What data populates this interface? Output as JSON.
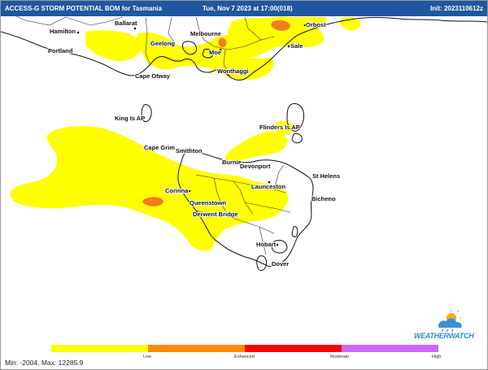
{
  "header": {
    "title": "ACCESS-G STORM POTENTIAL BOM for Tasmania",
    "valid_time": "Tue, Nov 7 2023 at 17:00(018)",
    "init_time": "Init: 2023110612z"
  },
  "places": [
    "Hamilton",
    "Ballarat",
    "Geelong",
    "Melbourne",
    "Orbost",
    "Portland",
    "Moe",
    "Sale",
    "Wonthaggi",
    "Cape Otway",
    "King Is AP",
    "Flinders Is AP",
    "Cape Grim",
    "Smithton",
    "Burnie",
    "Devonport",
    "St Helens",
    "Launceston",
    "Corinna",
    "Bicheno",
    "Queenstown",
    "Derwent Bridge",
    "Hobart",
    "Dover"
  ],
  "legend": {
    "labels": [
      "Low",
      "Enhanced",
      "Moderate",
      "High"
    ],
    "colors": [
      "#ffff00",
      "#ff8c00",
      "#ff0000",
      "#cc66ff"
    ]
  },
  "stats": "Min: -2004, Max: 12285.9",
  "logo": {
    "text": "WEATHERWATCH",
    "icon": "cloud-sun-rain-icon"
  },
  "colors": {
    "header": "#1f58a0",
    "storm_low": "#ffff00",
    "storm_enhanced": "#f07d22",
    "coast": "#111111",
    "boundary": "#333333"
  }
}
